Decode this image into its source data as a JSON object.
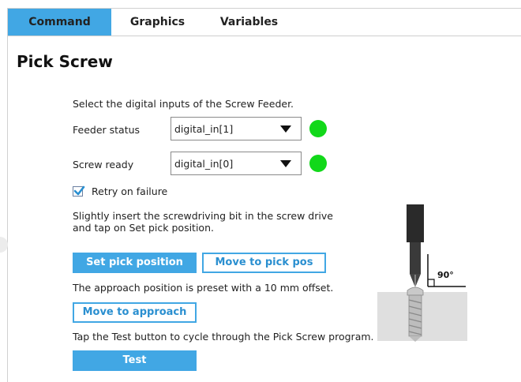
{
  "tabs": [
    {
      "label": "Command",
      "active": true
    },
    {
      "label": "Graphics",
      "active": false
    },
    {
      "label": "Variables",
      "active": false
    }
  ],
  "page_title": "Pick Screw",
  "instructions": {
    "select_inputs": "Select the digital inputs of the Screw Feeder.",
    "insert_line1": "Slightly insert the screwdriving bit in the screw drive",
    "insert_line2": "and tap on Set pick position.",
    "approach_offset": "The approach position is preset with a 10 mm offset.",
    "test_hint": "Tap the Test button to cycle through the Pick Screw program."
  },
  "feeder_status": {
    "label": "Feeder status",
    "value": "digital_in[1]",
    "status_color": "#12d81a"
  },
  "screw_ready": {
    "label": "Screw ready",
    "value": "digital_in[0]",
    "status_color": "#12d81a"
  },
  "retry": {
    "label": "Retry on failure",
    "checked": true
  },
  "buttons": {
    "set_pick": "Set pick position",
    "move_pick": "Move to pick pos",
    "move_approach": "Move to approach",
    "test": "Test"
  },
  "illustration": {
    "angle_label": "90°"
  },
  "colors": {
    "accent": "#41a7e4",
    "ok": "#12d81a"
  }
}
